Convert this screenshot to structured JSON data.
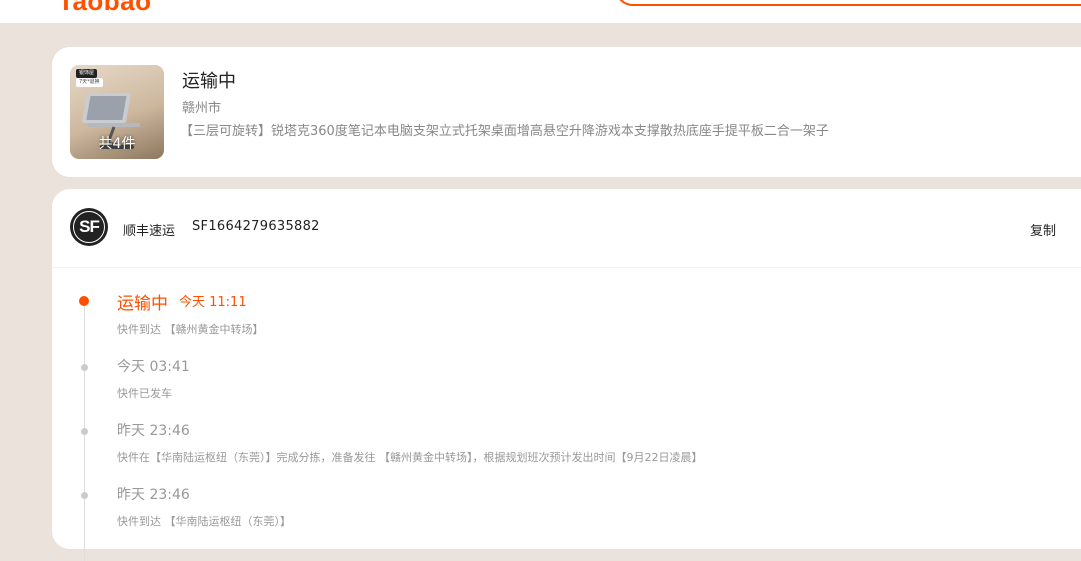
{
  "brand": {
    "logo_text": "Taobao",
    "accent_color": "#ff5000"
  },
  "order": {
    "item_count_label": "共4件",
    "thumb_badge_1": "银饰屋",
    "thumb_badge_2": "7天*退换",
    "status": "运输中",
    "city": "赣州市",
    "product_title": "【三层可旋转】锐塔克360度笔记本电脑支架立式托架桌面增高悬空升降游戏本支撑散热底座手提平板二合一架子"
  },
  "shipment": {
    "carrier_logo": "SF",
    "carrier_name": "顺丰速运",
    "tracking_number": "SF1664279635882",
    "copy_label": "复制"
  },
  "timeline": [
    {
      "status": "运输中",
      "time": "今天 11:11",
      "desc": "快件到达 【赣州黄金中转场】",
      "active": true
    },
    {
      "time": "今天 03:41",
      "desc": "快件已发车",
      "active": false
    },
    {
      "time": "昨天 23:46",
      "desc": "快件在【华南陆运枢纽（东莞）】完成分拣，准备发往 【赣州黄金中转场】，根据规划班次预计发出时间【9月22日凌晨】",
      "active": false
    },
    {
      "time": "昨天 23:46",
      "desc": "快件到达 【华南陆运枢纽（东莞）】",
      "active": false
    }
  ]
}
